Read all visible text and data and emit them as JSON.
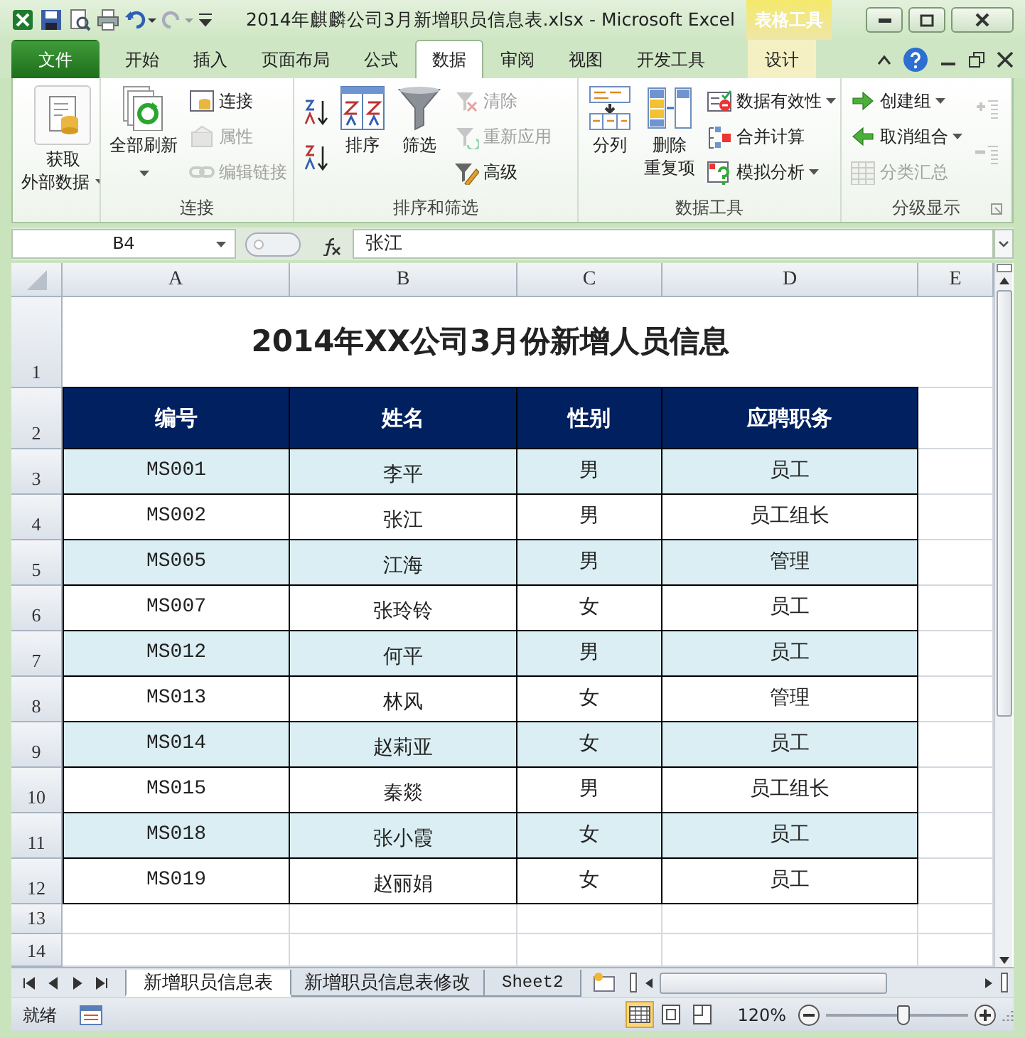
{
  "window": {
    "title": "2014年麒麟公司3月新增职员信息表.xlsx  -  Microsoft Excel",
    "context_label": "表格工具"
  },
  "ribbon_tabs": [
    {
      "label": "文件",
      "kind": "file",
      "selected": false
    },
    {
      "label": "开始",
      "kind": "tab",
      "selected": false
    },
    {
      "label": "插入",
      "kind": "tab",
      "selected": false
    },
    {
      "label": "页面布局",
      "kind": "tab",
      "selected": false
    },
    {
      "label": "公式",
      "kind": "tab",
      "selected": false
    },
    {
      "label": "数据",
      "kind": "tab",
      "selected": true
    },
    {
      "label": "审阅",
      "kind": "tab",
      "selected": false
    },
    {
      "label": "视图",
      "kind": "tab",
      "selected": false
    },
    {
      "label": "开发工具",
      "kind": "tab",
      "selected": false
    },
    {
      "label": "设计",
      "kind": "context",
      "selected": false
    }
  ],
  "ribbon_groups": [
    {
      "columns": [
        [
          {
            "kind": "large",
            "lines": [
              "获取",
              "外部数据"
            ],
            "dropdown": true,
            "disabled": false
          }
        ]
      ]
    },
    {
      "label": "连接",
      "columns": [
        [
          {
            "kind": "large",
            "lines": [
              "全部刷新"
            ],
            "dropdown": true,
            "disabled": false
          }
        ],
        [
          {
            "kind": "small",
            "label": "连接",
            "disabled": false
          },
          {
            "kind": "small",
            "label": "属性",
            "disabled": true
          },
          {
            "kind": "small",
            "label": "编辑链接",
            "disabled": true
          }
        ]
      ]
    },
    {
      "label": "排序和筛选",
      "columns": [
        [
          {
            "kind": "icon",
            "disabled": false
          },
          {
            "kind": "icon",
            "disabled": false
          }
        ],
        [
          {
            "kind": "large",
            "lines": [
              "排序"
            ],
            "disabled": false
          }
        ],
        [
          {
            "kind": "large",
            "lines": [
              "筛选"
            ],
            "disabled": false
          }
        ],
        [
          {
            "kind": "small",
            "label": "清除",
            "disabled": true
          },
          {
            "kind": "small",
            "label": "重新应用",
            "disabled": true
          },
          {
            "kind": "small",
            "label": "高级",
            "disabled": false
          }
        ]
      ]
    },
    {
      "label": "数据工具",
      "columns": [
        [
          {
            "kind": "large",
            "lines": [
              "分列"
            ],
            "disabled": false
          }
        ],
        [
          {
            "kind": "large",
            "lines": [
              "删除",
              "重复项"
            ],
            "disabled": false
          }
        ],
        [
          {
            "kind": "small",
            "label": "数据有效性",
            "dropdown": true,
            "disabled": false
          },
          {
            "kind": "small",
            "label": "合并计算",
            "disabled": false
          },
          {
            "kind": "small",
            "label": "模拟分析",
            "dropdown": true,
            "disabled": false
          }
        ]
      ]
    },
    {
      "label": "分级显示",
      "columns": [
        [
          {
            "kind": "small",
            "label": "创建组",
            "dropdown": true,
            "disabled": false
          },
          {
            "kind": "small",
            "label": "取消组合",
            "dropdown": true,
            "disabled": false
          },
          {
            "kind": "small",
            "label": "分类汇总",
            "disabled": true
          }
        ],
        [
          {
            "kind": "icon",
            "disabled": true
          },
          {
            "kind": "icon",
            "disabled": true
          }
        ]
      ]
    }
  ],
  "formula_bar": {
    "name_box": "B4",
    "formula": "张江"
  },
  "sheet": {
    "columns": [
      "A",
      "B",
      "C",
      "D",
      "E"
    ],
    "row_numbers": [
      "1",
      "2",
      "3",
      "4",
      "5",
      "6",
      "7",
      "8",
      "9",
      "10",
      "11",
      "12",
      "13",
      "14"
    ],
    "title": "2014年XX公司3月份新增人员信息",
    "headers": [
      "编号",
      "姓名",
      "性别",
      "应聘职务"
    ],
    "records": [
      {
        "id": "MS001",
        "name": "李平",
        "gender": "男",
        "position": "员工"
      },
      {
        "id": "MS002",
        "name": "张江",
        "gender": "男",
        "position": "员工组长"
      },
      {
        "id": "MS005",
        "name": "江海",
        "gender": "男",
        "position": "管理"
      },
      {
        "id": "MS007",
        "name": "张玲铃",
        "gender": "女",
        "position": "员工"
      },
      {
        "id": "MS012",
        "name": "何平",
        "gender": "男",
        "position": "员工"
      },
      {
        "id": "MS013",
        "name": "林风",
        "gender": "女",
        "position": "管理"
      },
      {
        "id": "MS014",
        "name": "赵莉亚",
        "gender": "女",
        "position": "员工"
      },
      {
        "id": "MS015",
        "name": "秦燚",
        "gender": "男",
        "position": "员工组长"
      },
      {
        "id": "MS018",
        "name": "张小霞",
        "gender": "女",
        "position": "员工"
      },
      {
        "id": "MS019",
        "name": "赵丽娟",
        "gender": "女",
        "position": "员工"
      }
    ]
  },
  "sheet_tabs": [
    {
      "label": "新增职员信息表",
      "selected": true
    },
    {
      "label": "新增职员信息表修改",
      "selected": false
    },
    {
      "label": "Sheet2",
      "selected": false
    }
  ],
  "status_bar": {
    "mode": "就绪",
    "zoom": "120%",
    "zoom_slider": {
      "level": 0.55
    }
  }
}
